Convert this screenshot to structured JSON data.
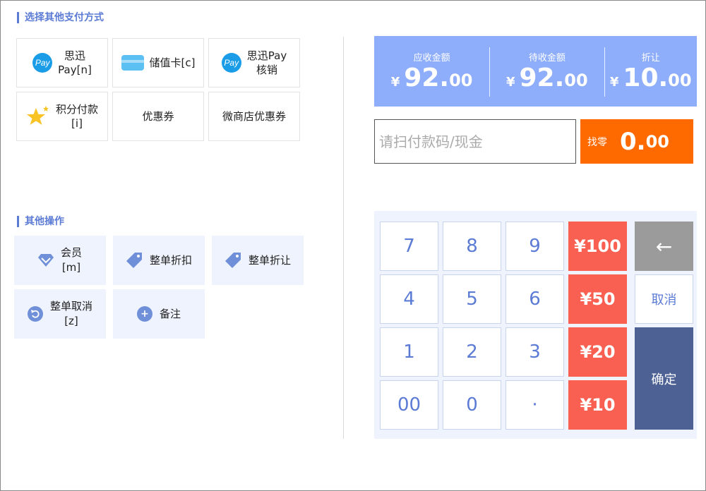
{
  "payment_section": {
    "title": "选择其他支付方式",
    "methods": [
      {
        "label": "思迅\nPay[n]",
        "icon": "pay-icon",
        "icon_text": "Pay"
      },
      {
        "label": "储值卡[c]",
        "icon": "card-icon"
      },
      {
        "label": "思迅Pay\n核销",
        "icon": "pay-icon",
        "icon_text": "Pay"
      },
      {
        "label": "积分付款\n[i]",
        "icon": "star-icon"
      },
      {
        "label": "优惠券"
      },
      {
        "label": "微商店优惠券"
      }
    ]
  },
  "other_ops": {
    "title": "其他操作",
    "items": [
      {
        "label": "会员\n[m]",
        "icon": "diamond-icon"
      },
      {
        "label": "整单折扣",
        "icon": "tag-icon"
      },
      {
        "label": "整单折让",
        "icon": "tag-icon"
      },
      {
        "label": "整单取消\n[z]",
        "icon": "undo-icon"
      },
      {
        "label": "备注",
        "icon": "plus-icon"
      }
    ]
  },
  "summary": {
    "receivable": {
      "label": "应收金额",
      "currency": "¥",
      "int": "92.",
      "dec": "00"
    },
    "pending": {
      "label": "待收金额",
      "currency": "¥",
      "int": "92.",
      "dec": "00"
    },
    "discount": {
      "label": "折让",
      "currency": "¥",
      "int": "10.",
      "dec": "00"
    }
  },
  "payment_input": {
    "placeholder": "请扫付款码/现金",
    "value": ""
  },
  "change": {
    "label": "找零",
    "int": "0.",
    "dec": "00"
  },
  "keypad": {
    "digits": [
      "7",
      "8",
      "9",
      "4",
      "5",
      "6",
      "1",
      "2",
      "3",
      "00",
      "0",
      "·"
    ],
    "quick_amounts": [
      "¥100",
      "¥50",
      "¥20",
      "¥10"
    ],
    "backspace": "←",
    "cancel": "取消",
    "confirm": "确定"
  },
  "colors": {
    "accent": "#5b7bd5",
    "summary_bg": "#8eadfb",
    "change_bg": "#ff6a00",
    "quick_amount_bg": "#f96052",
    "confirm_bg": "#4d6195",
    "backspace_bg": "#9b9b9b"
  }
}
